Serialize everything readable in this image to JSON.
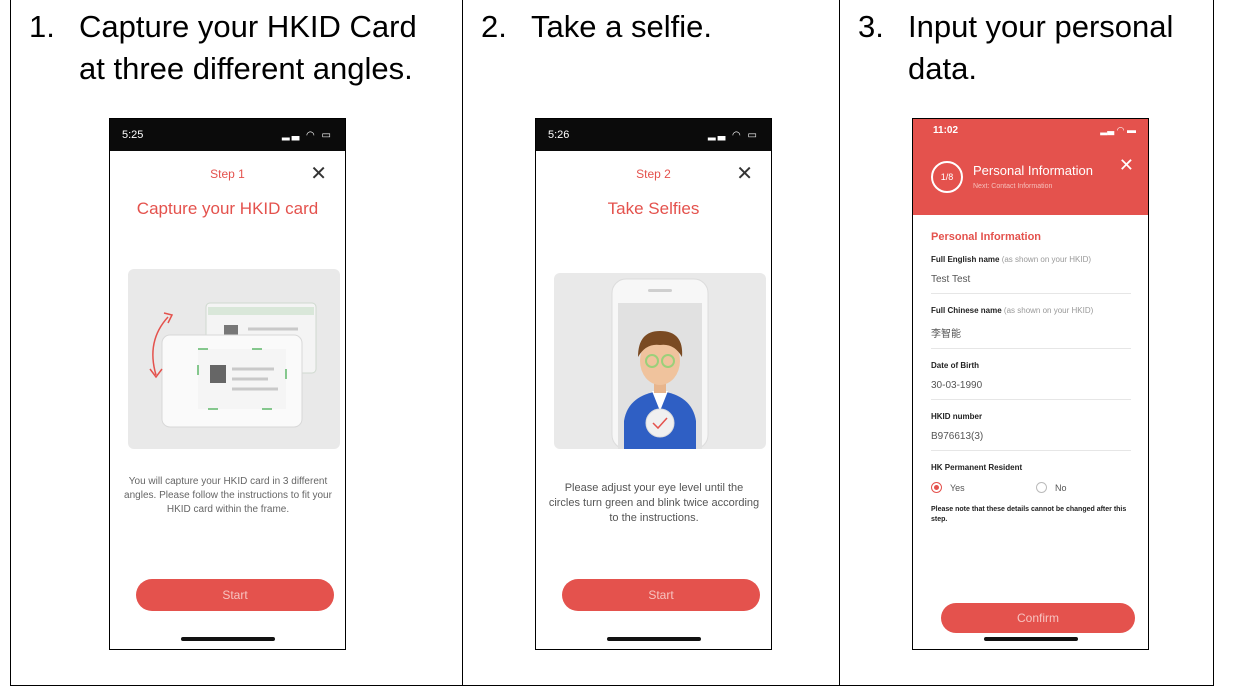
{
  "steps": [
    {
      "number": "1.",
      "caption": "Capture your HKID Card at three different angles.",
      "phone": {
        "time": "5:25",
        "step_label": "Step 1",
        "title": "Capture your HKID card",
        "description": "You will capture your HKID card in 3 different angles. Please follow the instructions to fit your HKID card within the frame.",
        "button": "Start"
      }
    },
    {
      "number": "2.",
      "caption": "Take a selfie.",
      "phone": {
        "time": "5:26",
        "step_label": "Step 2",
        "title": "Take Selfies",
        "description": "Please adjust your eye level until the circles turn green and blink twice according to the instructions.",
        "button": "Start"
      }
    },
    {
      "number": "3.",
      "caption": "Input your personal data.",
      "phone": {
        "time": "11:02",
        "progress": "1/8",
        "header_title": "Personal Information",
        "header_sub": "Next: Contact Information",
        "section": "Personal Information",
        "fields": [
          {
            "label": "Full English name",
            "hint": "(as shown on your HKID)",
            "value": "Test Test"
          },
          {
            "label": "Full Chinese name",
            "hint": "(as shown on your HKID)",
            "value": "李智能"
          },
          {
            "label": "Date of Birth",
            "hint": "",
            "value": "30-03-1990"
          },
          {
            "label": "HKID number",
            "hint": "",
            "value": "B976613(3)"
          }
        ],
        "resident_label": "HK Permanent Resident",
        "option_yes": "Yes",
        "option_no": "No",
        "note": "Please note that these details cannot be changed after this step.",
        "button": "Confirm"
      }
    }
  ],
  "colors": {
    "accent": "#e4524d",
    "status_bar": "#0b0b0b"
  }
}
